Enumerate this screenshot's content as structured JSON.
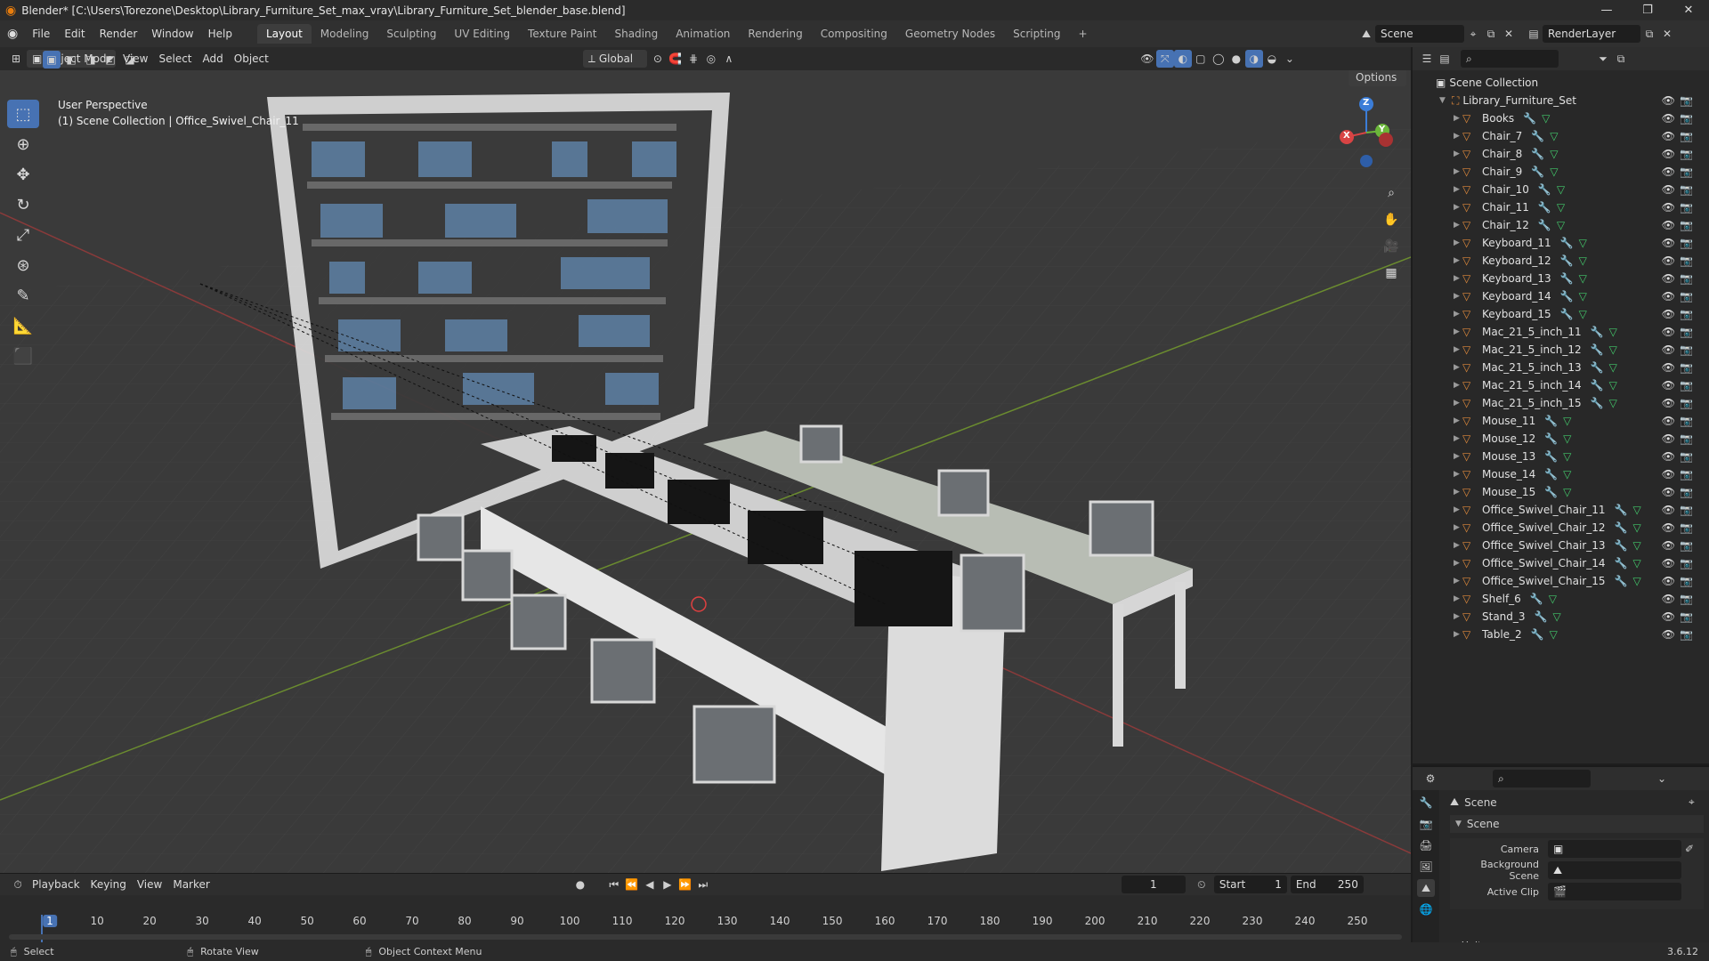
{
  "window": {
    "title": "Blender* [C:\\Users\\Torezone\\Desktop\\Library_Furniture_Set_max_vray\\Library_Furniture_Set_blender_base.blend]",
    "minimize": "—",
    "maximize": "❐",
    "close": "✕"
  },
  "menu": [
    "File",
    "Edit",
    "Render",
    "Window",
    "Help"
  ],
  "workspaces": [
    "Layout",
    "Modeling",
    "Sculpting",
    "UV Editing",
    "Texture Paint",
    "Shading",
    "Animation",
    "Rendering",
    "Compositing",
    "Geometry Nodes",
    "Scripting"
  ],
  "workspace_add": "+",
  "scene": {
    "name": "Scene",
    "render_layer": "RenderLayer"
  },
  "viewport_header": {
    "mode": "Object Mode",
    "menus": [
      "View",
      "Select",
      "Add",
      "Object"
    ],
    "orientation": "Global",
    "options": "Options"
  },
  "viewport": {
    "perspective": "User Perspective",
    "context": "(1) Scene Collection | Office_Swivel_Chair_11",
    "gizmo": {
      "x": "X",
      "y": "Y",
      "z": "Z"
    }
  },
  "outliner": {
    "root": "Scene Collection",
    "collection": "Library_Furniture_Set",
    "items": [
      "Books",
      "Chair_7",
      "Chair_8",
      "Chair_9",
      "Chair_10",
      "Chair_11",
      "Chair_12",
      "Keyboard_11",
      "Keyboard_12",
      "Keyboard_13",
      "Keyboard_14",
      "Keyboard_15",
      "Mac_21_5_inch_11",
      "Mac_21_5_inch_12",
      "Mac_21_5_inch_13",
      "Mac_21_5_inch_14",
      "Mac_21_5_inch_15",
      "Mouse_11",
      "Mouse_12",
      "Mouse_13",
      "Mouse_14",
      "Mouse_15",
      "Office_Swivel_Chair_11",
      "Office_Swivel_Chair_12",
      "Office_Swivel_Chair_13",
      "Office_Swivel_Chair_14",
      "Office_Swivel_Chair_15",
      "Shelf_6",
      "Stand_3",
      "Table_2"
    ]
  },
  "properties": {
    "header": "Scene",
    "panel": "Scene",
    "camera_label": "Camera",
    "background_label": "Background Scene",
    "clip_label": "Active Clip",
    "units_label": "Units"
  },
  "timeline": {
    "menus": [
      "Playback",
      "Keying",
      "View",
      "Marker"
    ],
    "current_frame": "1",
    "start_label": "Start",
    "start": "1",
    "end_label": "End",
    "end": "250",
    "ticks": [
      "1",
      "10",
      "20",
      "30",
      "40",
      "50",
      "60",
      "70",
      "80",
      "90",
      "100",
      "110",
      "120",
      "130",
      "140",
      "150",
      "160",
      "170",
      "180",
      "190",
      "200",
      "210",
      "220",
      "230",
      "240",
      "250"
    ]
  },
  "status": {
    "select": "Select",
    "rotate": "Rotate View",
    "context_menu": "Object Context Menu",
    "version": "3.6.12"
  },
  "colors": {
    "accent": "#4772b3",
    "mesh_icon": "#e08a3c",
    "modifier_icon": "#6aa8e0",
    "data_icon": "#43c96b"
  }
}
